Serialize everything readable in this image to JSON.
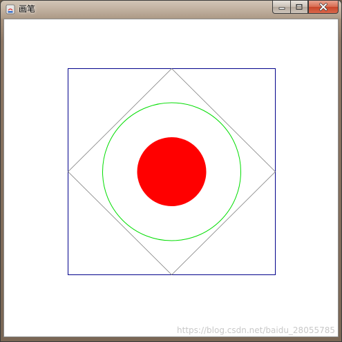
{
  "window": {
    "title": "画笔"
  },
  "controls": {
    "minimize_icon": "minimize-icon",
    "maximize_icon": "maximize-icon",
    "close_icon": "close-icon"
  },
  "drawing": {
    "square_color": "#00008b",
    "diamond_color": "#808080",
    "circle_color": "#00dd00",
    "filled_circle_color": "#ff0000"
  },
  "watermark": "https://blog.csdn.net/baidu_28055785"
}
